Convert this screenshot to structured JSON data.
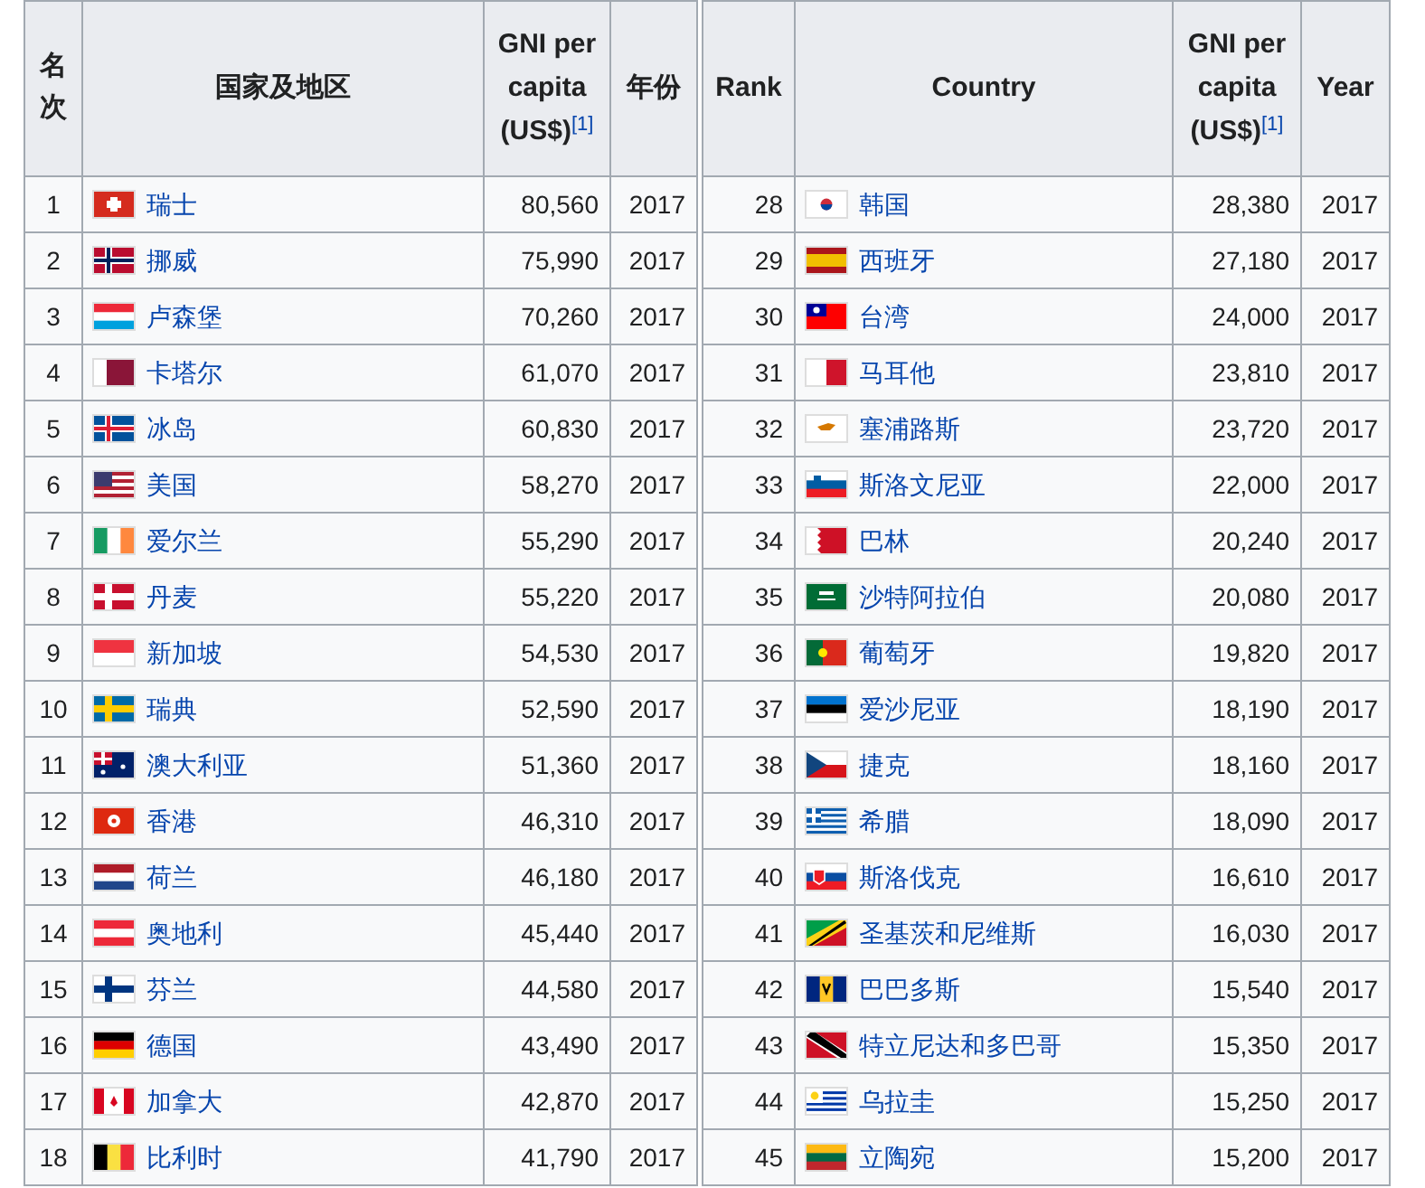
{
  "tables": [
    {
      "columns": [
        "名次",
        "国家及地区",
        "GNI per capita (US$)$^{[1]}$",
        "年份"
      ],
      "rows": [
        {
          "rank": "1",
          "country": "瑞士",
          "gni": "80,560",
          "year": "2017"
        },
        {
          "rank": "2",
          "country": "挪威",
          "gni": "75,990",
          "year": "2017"
        },
        {
          "rank": "3",
          "country": "卢森堡",
          "gni": "70,260",
          "year": "2017"
        },
        {
          "rank": "4",
          "country": "卡塔尔",
          "gni": "61,070",
          "year": "2017"
        },
        {
          "rank": "5",
          "country": "冰岛",
          "gni": "60,830",
          "year": "2017"
        },
        {
          "rank": "6",
          "country": "美国",
          "gni": "58,270",
          "year": "2017"
        },
        {
          "rank": "7",
          "country": "爱尔兰",
          "gni": "55,290",
          "year": "2017"
        },
        {
          "rank": "8",
          "country": "丹麦",
          "gni": "55,220",
          "year": "2017"
        },
        {
          "rank": "9",
          "country": "新加坡",
          "gni": "54,530",
          "year": "2017"
        },
        {
          "rank": "10",
          "country": "瑞典",
          "gni": "52,590",
          "year": "2017"
        },
        {
          "rank": "11",
          "country": "澳大利亚",
          "gni": "51,360",
          "year": "2017"
        },
        {
          "rank": "12",
          "country": "香港",
          "gni": "46,310",
          "year": "2017"
        },
        {
          "rank": "13",
          "country": "荷兰",
          "gni": "46,180",
          "year": "2017"
        },
        {
          "rank": "14",
          "country": "奥地利",
          "gni": "45,440",
          "year": "2017"
        },
        {
          "rank": "15",
          "country": "芬兰",
          "gni": "44,580",
          "year": "2017"
        },
        {
          "rank": "16",
          "country": "德国",
          "gni": "43,490",
          "year": "2017"
        },
        {
          "rank": "17",
          "country": "加拿大",
          "gni": "42,870",
          "year": "2017"
        },
        {
          "rank": "18",
          "country": "比利时",
          "gni": "41,790",
          "year": "2017"
        }
      ]
    },
    {
      "columns": [
        "Rank",
        "Country",
        "GNI per capita (US$)$^{[1]}$",
        "Year"
      ],
      "rows": [
        {
          "rank": "28",
          "country": "韩国",
          "gni": "28,380",
          "year": "2017"
        },
        {
          "rank": "29",
          "country": "西班牙",
          "gni": "27,180",
          "year": "2017"
        },
        {
          "rank": "30",
          "country": "台湾",
          "gni": "24,000",
          "year": "2017"
        },
        {
          "rank": "31",
          "country": "马耳他",
          "gni": "23,810",
          "year": "2017"
        },
        {
          "rank": "32",
          "country": "塞浦路斯",
          "gni": "23,720",
          "year": "2017"
        },
        {
          "rank": "33",
          "country": "斯洛文尼亚",
          "gni": "22,000",
          "year": "2017"
        },
        {
          "rank": "34",
          "country": "巴林",
          "gni": "20,240",
          "year": "2017"
        },
        {
          "rank": "35",
          "country": "沙特阿拉伯",
          "gni": "20,080",
          "year": "2017"
        },
        {
          "rank": "36",
          "country": "葡萄牙",
          "gni": "19,820",
          "year": "2017"
        },
        {
          "rank": "37",
          "country": "爱沙尼亚",
          "gni": "18,190",
          "year": "2017"
        },
        {
          "rank": "38",
          "country": "捷克",
          "gni": "18,160",
          "year": "2017"
        },
        {
          "rank": "39",
          "country": "希腊",
          "gni": "18,090",
          "year": "2017"
        },
        {
          "rank": "40",
          "country": "斯洛伐克",
          "gni": "16,610",
          "year": "2017"
        },
        {
          "rank": "41",
          "country": "圣基茨和尼维斯",
          "gni": "16,030",
          "year": "2017"
        },
        {
          "rank": "42",
          "country": "巴巴多斯",
          "gni": "15,540",
          "year": "2017"
        },
        {
          "rank": "43",
          "country": "特立尼达和多巴哥",
          "gni": "15,350",
          "year": "2017"
        },
        {
          "rank": "44",
          "country": "乌拉圭",
          "gni": "15,250",
          "year": "2017"
        },
        {
          "rank": "45",
          "country": "立陶宛",
          "gni": "15,200",
          "year": "2017"
        }
      ]
    }
  ]
}
